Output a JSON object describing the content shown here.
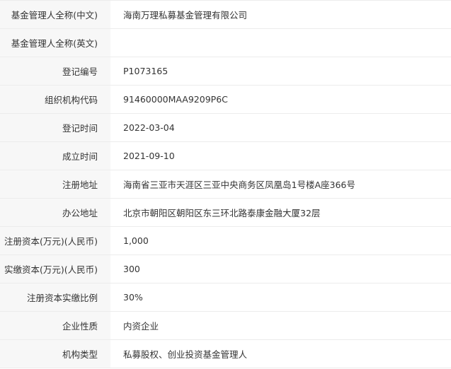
{
  "rows": [
    {
      "label": "基金管理人全称(中文)",
      "value": "海南万理私募基金管理有限公司"
    },
    {
      "label": "基金管理人全称(英文)",
      "value": ""
    },
    {
      "label": "登记编号",
      "value": "P1073165"
    },
    {
      "label": "组织机构代码",
      "value": "91460000MAA9209P6C"
    },
    {
      "label": "登记时间",
      "value": "2022-03-04"
    },
    {
      "label": "成立时间",
      "value": "2021-09-10"
    },
    {
      "label": "注册地址",
      "value": "海南省三亚市天涯区三亚中央商务区凤凰岛1号楼A座366号"
    },
    {
      "label": "办公地址",
      "value": "北京市朝阳区朝阳区东三环北路泰康金融大厦32层"
    },
    {
      "label": "注册资本(万元)(人民币)",
      "value": "1,000"
    },
    {
      "label": "实缴资本(万元)(人民币)",
      "value": "300"
    },
    {
      "label": "注册资本实缴比例",
      "value": "30%"
    },
    {
      "label": "企业性质",
      "value": "内资企业"
    },
    {
      "label": "机构类型",
      "value": "私募股权、创业投资基金管理人"
    }
  ]
}
